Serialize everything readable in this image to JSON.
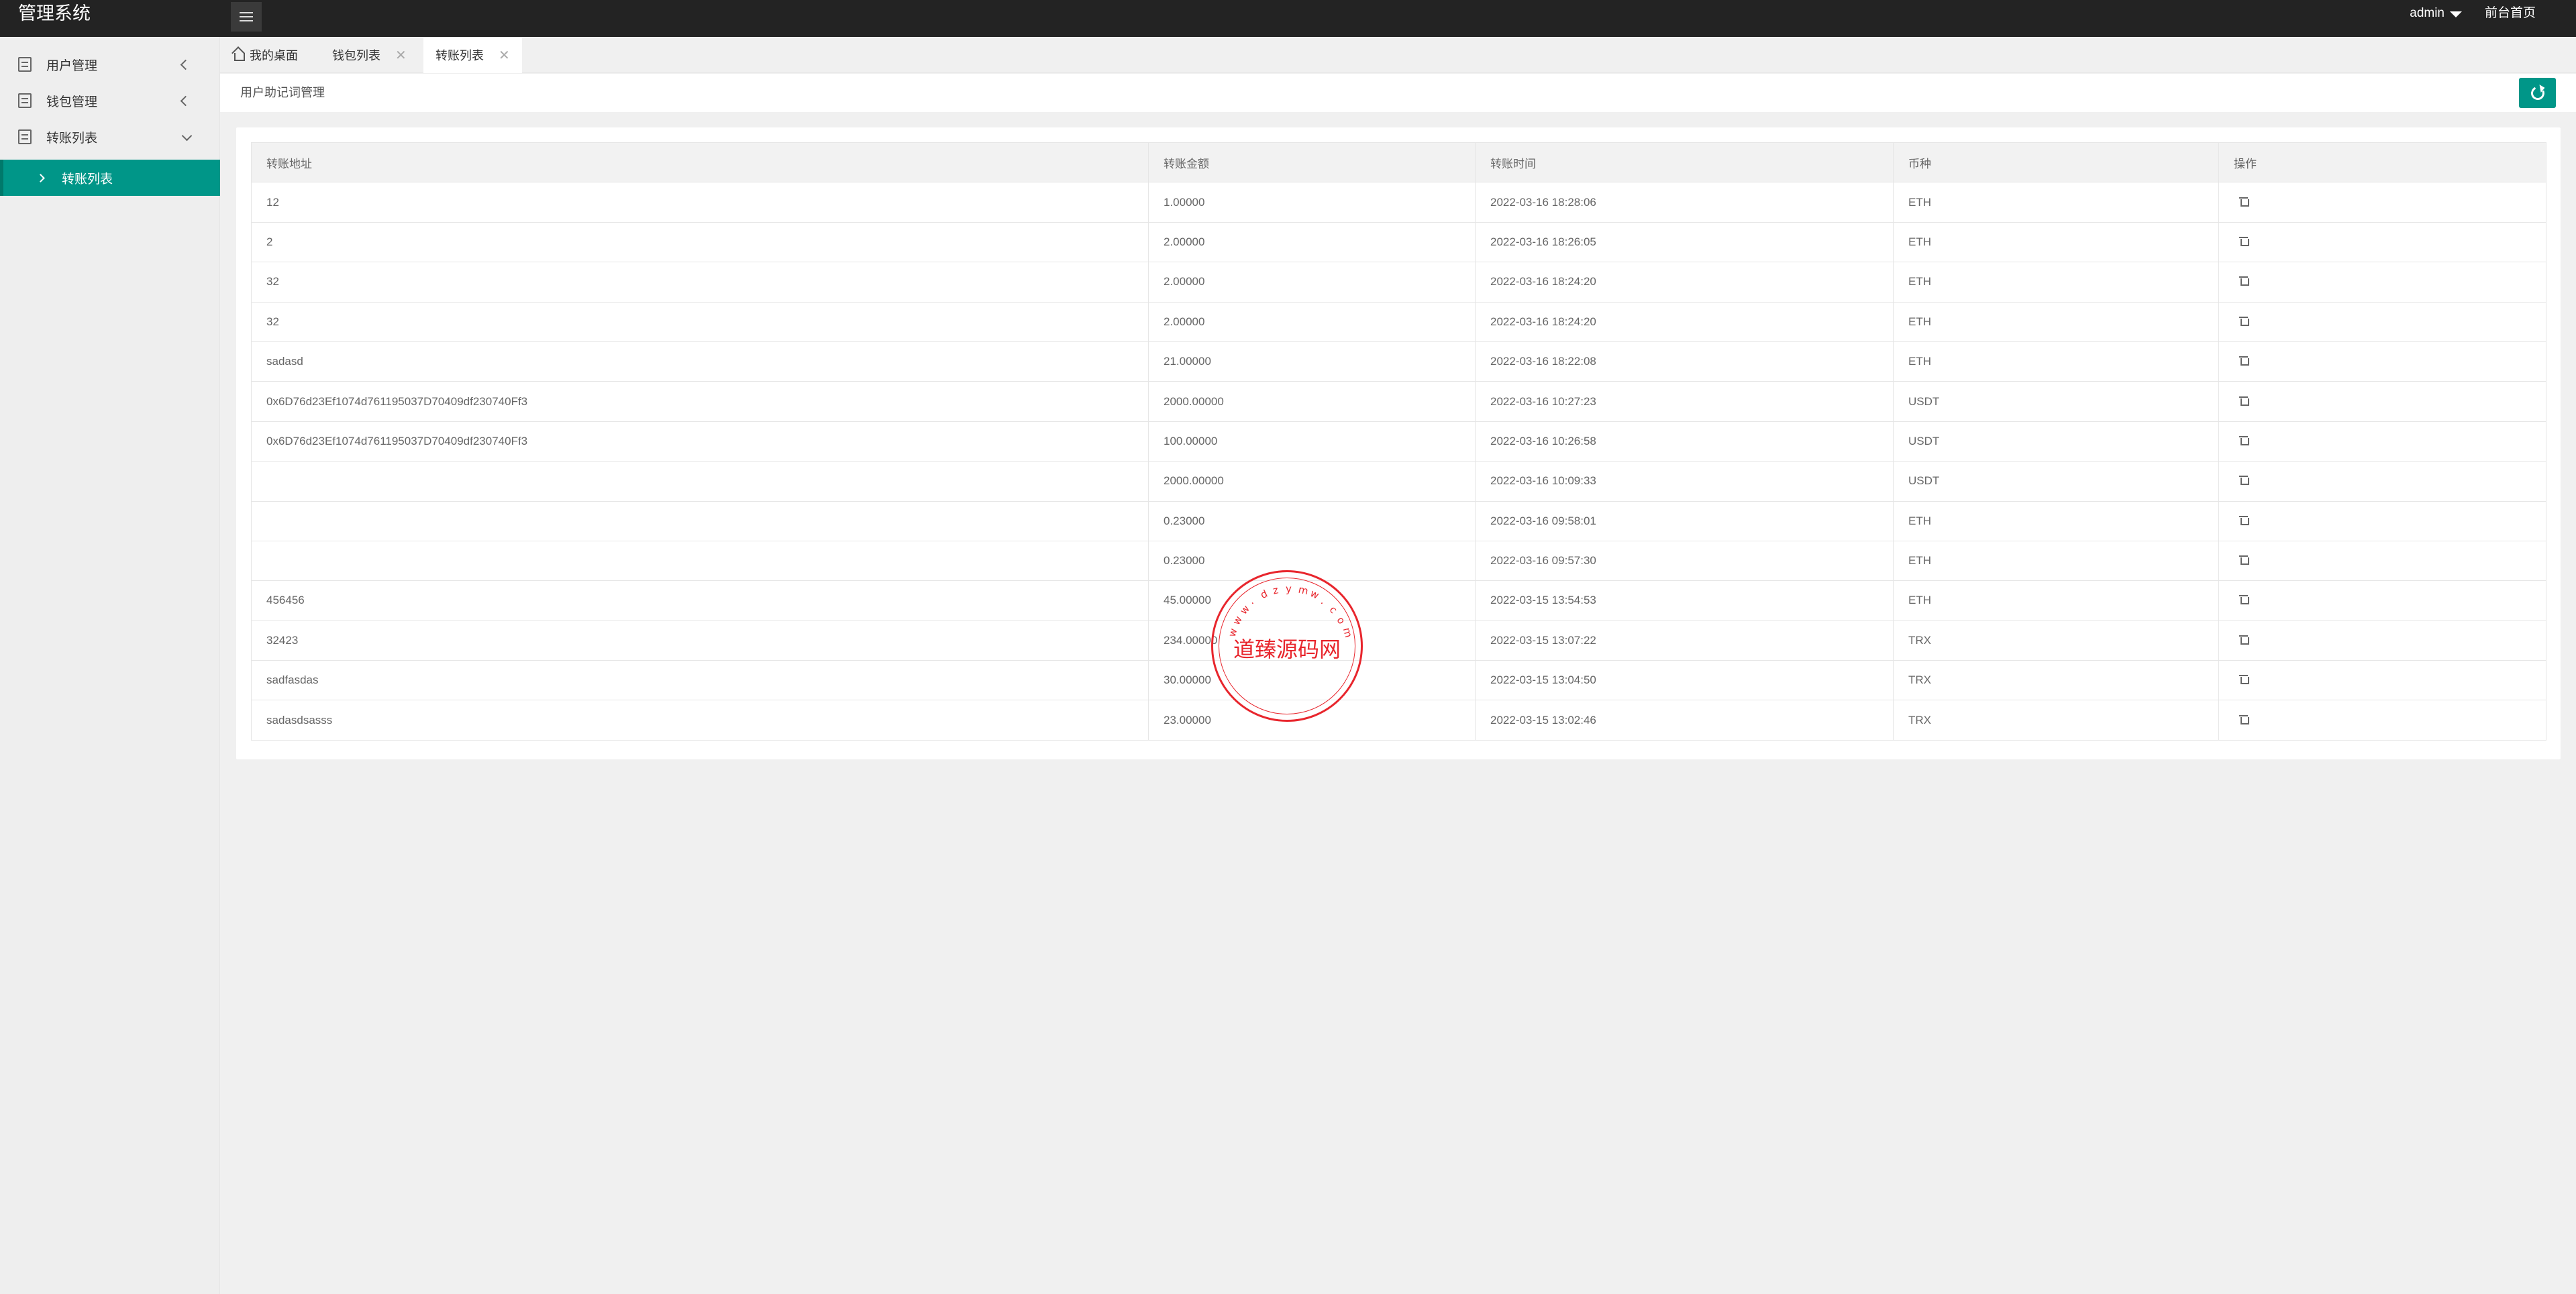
{
  "header": {
    "logo": "管理系统",
    "user": "admin",
    "front_link": "前台首页"
  },
  "sidebar": {
    "items": [
      {
        "label": "用户管理",
        "icon": "document-icon",
        "expanded": false
      },
      {
        "label": "钱包管理",
        "icon": "document-icon",
        "expanded": false
      },
      {
        "label": "转账列表",
        "icon": "document-icon",
        "expanded": true
      }
    ],
    "sub_item": {
      "label": "转账列表",
      "active": true
    }
  },
  "tabs": [
    {
      "label": "我的桌面",
      "icon": "home-icon",
      "closable": false,
      "active": false
    },
    {
      "label": "钱包列表",
      "closable": true,
      "active": false
    },
    {
      "label": "转账列表",
      "closable": true,
      "active": true
    }
  ],
  "breadcrumb": "用户助记词管理",
  "table": {
    "columns": [
      "转账地址",
      "转账金额",
      "转账时间",
      "币种",
      "操作"
    ],
    "rows": [
      {
        "address": "12",
        "amount": "1.00000",
        "time": "2022-03-16 18:28:06",
        "coin": "ETH"
      },
      {
        "address": "2",
        "amount": "2.00000",
        "time": "2022-03-16 18:26:05",
        "coin": "ETH"
      },
      {
        "address": "32",
        "amount": "2.00000",
        "time": "2022-03-16 18:24:20",
        "coin": "ETH"
      },
      {
        "address": "32",
        "amount": "2.00000",
        "time": "2022-03-16 18:24:20",
        "coin": "ETH"
      },
      {
        "address": "sadasd",
        "amount": "21.00000",
        "time": "2022-03-16 18:22:08",
        "coin": "ETH"
      },
      {
        "address": "0x6D76d23Ef1074d761195037D70409df230740Ff3",
        "amount": "2000.00000",
        "time": "2022-03-16 10:27:23",
        "coin": "USDT"
      },
      {
        "address": "0x6D76d23Ef1074d761195037D70409df230740Ff3",
        "amount": "100.00000",
        "time": "2022-03-16 10:26:58",
        "coin": "USDT"
      },
      {
        "address": "",
        "amount": "2000.00000",
        "time": "2022-03-16 10:09:33",
        "coin": "USDT"
      },
      {
        "address": "",
        "amount": "0.23000",
        "time": "2022-03-16 09:58:01",
        "coin": "ETH"
      },
      {
        "address": "",
        "amount": "0.23000",
        "time": "2022-03-16 09:57:30",
        "coin": "ETH"
      },
      {
        "address": "456456",
        "amount": "45.00000",
        "time": "2022-03-15 13:54:53",
        "coin": "ETH"
      },
      {
        "address": "32423",
        "amount": "234.00000",
        "time": "2022-03-15 13:07:22",
        "coin": "TRX"
      },
      {
        "address": "sadfasdas",
        "amount": "30.00000",
        "time": "2022-03-15 13:04:50",
        "coin": "TRX"
      },
      {
        "address": "sadasdsasss",
        "amount": "23.00000",
        "time": "2022-03-15 13:02:46",
        "coin": "TRX"
      }
    ]
  },
  "watermark": {
    "center_text": "道臻源码网",
    "arc_text": "www.dzymw.com"
  },
  "colors": {
    "header_bg": "#232323",
    "accent": "#009688",
    "seal": "#e8262d"
  }
}
